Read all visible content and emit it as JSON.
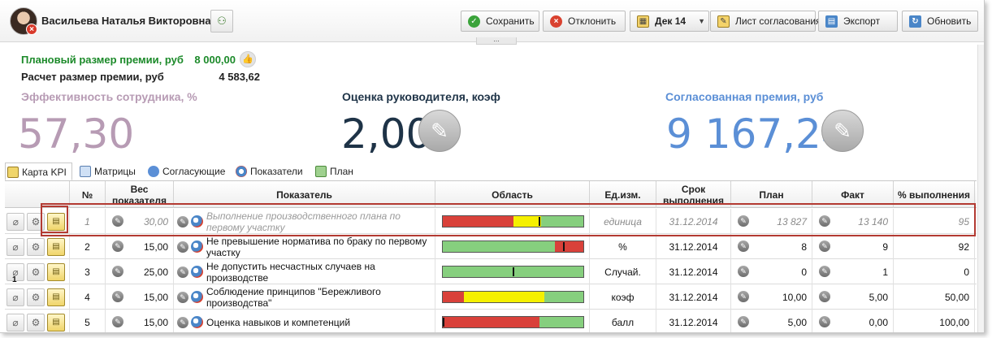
{
  "user": {
    "name": "Васильева Наталья Викторовна"
  },
  "toolbar": {
    "save_label": "Сохранить",
    "reject_label": "Отклонить",
    "month_label": "Дек 14",
    "approval_sheet_label": "Лист согласования",
    "export_label": "Экспорт",
    "refresh_label": "Обновить"
  },
  "bonus": {
    "planned_label": "Плановый размер премии, руб",
    "planned_value": "8 000,00",
    "calculated_label": "Расчет размер премии, руб",
    "calculated_value": "4 583,62"
  },
  "kpis": [
    {
      "title": "Эффективность сотрудника, %",
      "value": "57,30",
      "color": "#b79bb4"
    },
    {
      "title": "Оценка руководителя, коэф",
      "value": "2,00",
      "color": "#1e3347"
    },
    {
      "title": "Согласованная премия, руб",
      "value": "9 167,24",
      "color": "#5b8fd6"
    }
  ],
  "tabs": [
    "Карта KPI",
    "Матрицы",
    "Согласующие",
    "Показатели",
    "План"
  ],
  "table": {
    "headers": [
      "№",
      "Вес показателя",
      "Показатель",
      "Область",
      "Ед.изм.",
      "Срок выполнения",
      "План",
      "Факт",
      "% выполнения"
    ],
    "rows": [
      {
        "num": "1",
        "weight": "30,00",
        "name": "Выполнение производственного плана по первому участку",
        "unit": "единица",
        "deadline": "31.12.2014",
        "plan": "13 827",
        "fact": "13 140",
        "percent": "95",
        "inactive": true,
        "area": {
          "segments": [
            {
              "color": "#d9413a",
              "width": 0.5
            },
            {
              "color": "#f5f000",
              "width": 0.2
            },
            {
              "color": "#86cf7e",
              "width": 0.3
            }
          ],
          "marker": 0.69
        }
      },
      {
        "num": "2",
        "weight": "15,00",
        "name": "Не превышение норматива по браку по первому участку",
        "unit": "%",
        "deadline": "31.12.2014",
        "plan": "8",
        "fact": "9",
        "percent": "92",
        "inactive": false,
        "area": {
          "segments": [
            {
              "color": "#86cf7e",
              "width": 0.8
            },
            {
              "color": "#d9413a",
              "width": 0.2
            }
          ],
          "marker": 0.86
        }
      },
      {
        "num": "3",
        "weight": "25,00",
        "name": "Не допустить несчастных случаев на производстве",
        "unit": "Случай.",
        "deadline": "31.12.2014",
        "plan": "0",
        "fact": "1",
        "percent": "0",
        "inactive": false,
        "area": {
          "segments": [
            {
              "color": "#86cf7e",
              "width": 1.0
            }
          ],
          "marker": 0.5
        }
      },
      {
        "num": "4",
        "weight": "15,00",
        "name": "Соблюдение принципов \"Бережливого производства\"",
        "unit": "коэф",
        "deadline": "31.12.2014",
        "plan": "10,00",
        "fact": "5,00",
        "percent": "50,00",
        "inactive": false,
        "area": {
          "segments": [
            {
              "color": "#d9413a",
              "width": 0.15
            },
            {
              "color": "#f5f000",
              "width": 0.57
            },
            {
              "color": "#86cf7e",
              "width": 0.28
            }
          ],
          "marker": null
        }
      },
      {
        "num": "5",
        "weight": "15,00",
        "name": "Оценка навыков и компетенций",
        "unit": "балл",
        "deadline": "31.12.2014",
        "plan": "5,00",
        "fact": "0,00",
        "percent": "100,00",
        "inactive": false,
        "area": {
          "segments": [
            {
              "color": "#d9413a",
              "width": 0.69
            },
            {
              "color": "#86cf7e",
              "width": 0.31
            }
          ],
          "marker": 0.0
        }
      }
    ]
  }
}
